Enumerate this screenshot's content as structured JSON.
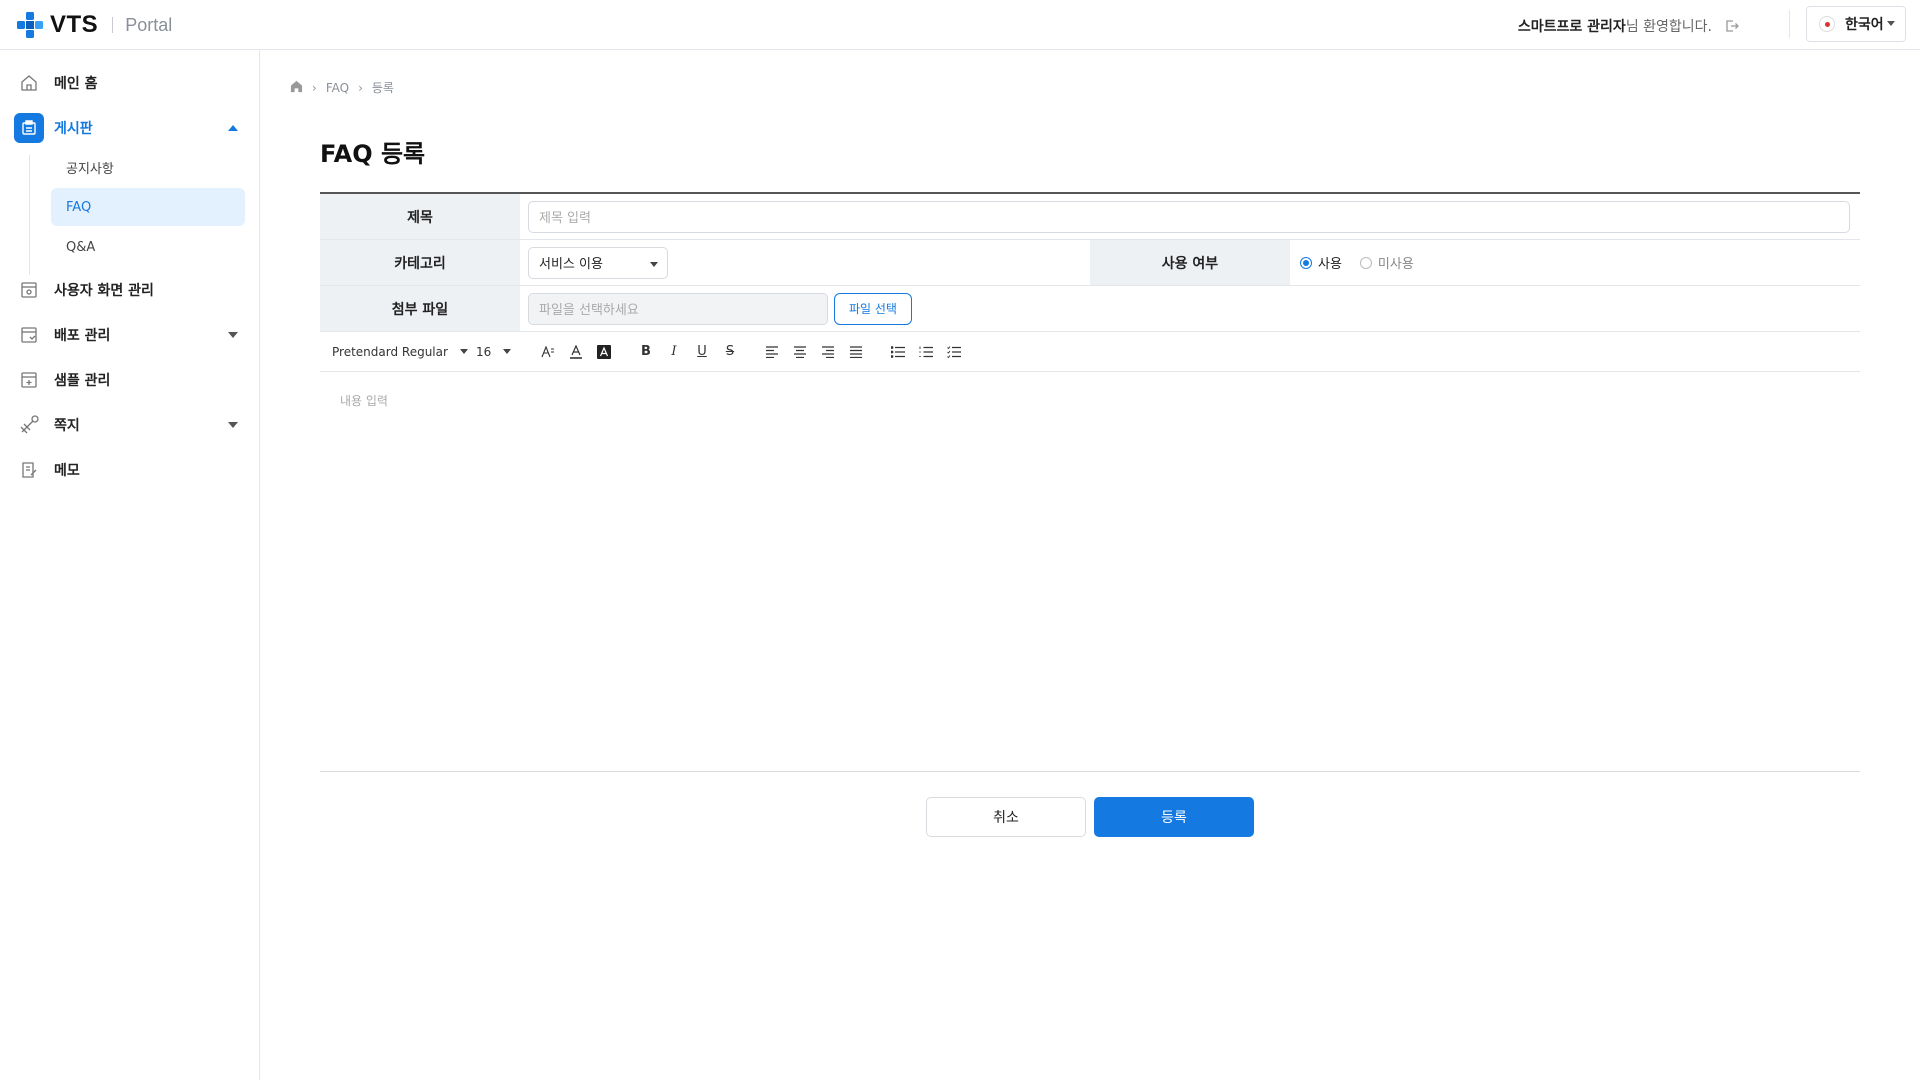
{
  "header": {
    "logo_text": "VTS",
    "logo_sub": "Portal",
    "welcome_name": "스마트프로 관리자",
    "welcome_tail": "님 환영합니다.",
    "language": "한국어"
  },
  "sidebar": {
    "items": [
      {
        "label": "메인 홈",
        "icon": "home-icon"
      },
      {
        "label": "게시판",
        "icon": "board-icon"
      },
      {
        "label": "사용자 화면 관리",
        "icon": "screen-settings-icon"
      },
      {
        "label": "배포 관리",
        "icon": "deploy-icon"
      },
      {
        "label": "샘플 관리",
        "icon": "sample-icon"
      },
      {
        "label": "쪽지",
        "icon": "message-icon"
      },
      {
        "label": "메모",
        "icon": "memo-icon"
      }
    ],
    "board_sub": [
      {
        "label": "공지사항"
      },
      {
        "label": "FAQ"
      },
      {
        "label": "Q&A"
      }
    ]
  },
  "breadcrumb": [
    "FAQ",
    "등록"
  ],
  "page_title": "FAQ 등록",
  "form": {
    "title_label": "제목",
    "title_placeholder": "제목 입력",
    "category_label": "카테고리",
    "category_value": "서비스 이용",
    "use_label": "사용 여부",
    "use_on": "사용",
    "use_off": "미사용",
    "file_label": "첨부 파일",
    "file_placeholder": "파일을 선택하세요",
    "file_button": "파일 선택"
  },
  "editor": {
    "font": "Pretendard Regular",
    "size": "16",
    "placeholder": "내용 입력"
  },
  "actions": {
    "cancel": "취소",
    "submit": "등록"
  },
  "colors": {
    "accent": "#1479e0",
    "active_bg": "#e3f0fd"
  }
}
